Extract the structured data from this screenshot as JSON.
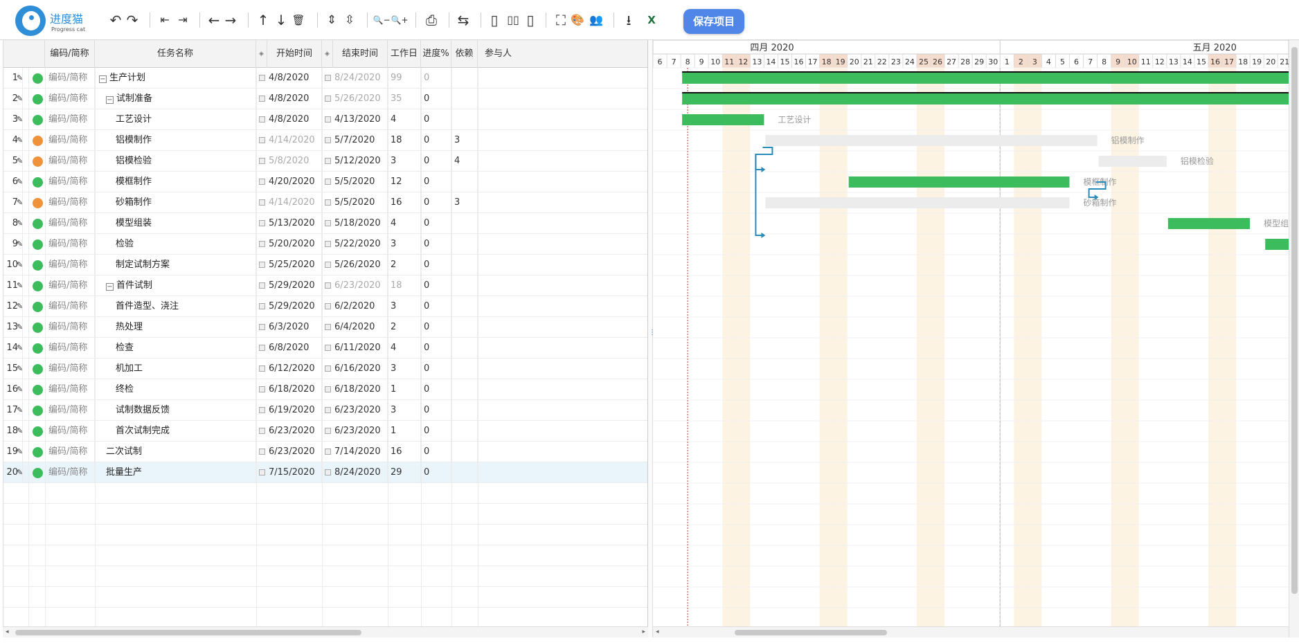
{
  "app": {
    "name": "进度猫",
    "subtitle": "Progress cat"
  },
  "toolbar": {
    "undo": "↶",
    "redo": "↷",
    "outdent": "⇤",
    "indent": "⇥",
    "move_left": "←",
    "move_right": "→",
    "move_up": "↑",
    "move_down": "↓",
    "delete": "🗑",
    "expand_all": "⇕",
    "collapse_all": "⇳",
    "zoom_out": "🔍−",
    "zoom_in": "🔍+",
    "print": "⎙",
    "critical_path": "⇆",
    "layout_grid": "▯",
    "layout_split": "▯▯",
    "layout_gantt": "▯",
    "fullscreen": "⛶",
    "theme": "🎨",
    "members": "👥",
    "export": "⭳",
    "excel": "X",
    "save_label": "保存项目"
  },
  "grid": {
    "headers": {
      "code": "编码/简称",
      "name": "任务名称",
      "start": "开始时间",
      "end": "结束时间",
      "workdays": "工作日",
      "progress": "进度%",
      "depends": "依赖",
      "people": "参与人"
    },
    "rows": [
      {
        "num": "1",
        "status": "green",
        "code": "编码/简称",
        "name": "生产计划",
        "indent": 0,
        "toggle": "−",
        "start": "4/8/2020",
        "start_grey": false,
        "end": "8/24/2020",
        "end_grey": true,
        "workdays": "99",
        "workdays_grey": true,
        "progress": "0",
        "progress_grey": true,
        "depends": ""
      },
      {
        "num": "2",
        "status": "green",
        "code": "编码/简称",
        "name": "试制准备",
        "indent": 1,
        "toggle": "−",
        "start": "4/8/2020",
        "start_grey": false,
        "end": "5/26/2020",
        "end_grey": true,
        "workdays": "35",
        "workdays_grey": true,
        "progress": "0",
        "progress_grey": false,
        "depends": ""
      },
      {
        "num": "3",
        "status": "green",
        "code": "编码/简称",
        "name": "工艺设计",
        "indent": 2,
        "toggle": "",
        "start": "4/8/2020",
        "start_grey": false,
        "end": "4/13/2020",
        "end_grey": false,
        "workdays": "4",
        "workdays_grey": false,
        "progress": "0",
        "progress_grey": false,
        "depends": ""
      },
      {
        "num": "4",
        "status": "orange",
        "code": "编码/简称",
        "name": "铝模制作",
        "indent": 2,
        "toggle": "",
        "start": "4/14/2020",
        "start_grey": true,
        "end": "5/7/2020",
        "end_grey": false,
        "workdays": "18",
        "workdays_grey": false,
        "progress": "0",
        "progress_grey": false,
        "depends": "3"
      },
      {
        "num": "5",
        "status": "orange",
        "code": "编码/简称",
        "name": "铝模检验",
        "indent": 2,
        "toggle": "",
        "start": "5/8/2020",
        "start_grey": true,
        "end": "5/12/2020",
        "end_grey": false,
        "workdays": "3",
        "workdays_grey": false,
        "progress": "0",
        "progress_grey": false,
        "depends": "4"
      },
      {
        "num": "6",
        "status": "green",
        "code": "编码/简称",
        "name": "模框制作",
        "indent": 2,
        "toggle": "",
        "start": "4/20/2020",
        "start_grey": false,
        "end": "5/5/2020",
        "end_grey": false,
        "workdays": "12",
        "workdays_grey": false,
        "progress": "0",
        "progress_grey": false,
        "depends": ""
      },
      {
        "num": "7",
        "status": "orange",
        "code": "编码/简称",
        "name": "砂箱制作",
        "indent": 2,
        "toggle": "",
        "start": "4/14/2020",
        "start_grey": true,
        "end": "5/5/2020",
        "end_grey": false,
        "workdays": "16",
        "workdays_grey": false,
        "progress": "0",
        "progress_grey": false,
        "depends": "3"
      },
      {
        "num": "8",
        "status": "green",
        "code": "编码/简称",
        "name": "模型组装",
        "indent": 2,
        "toggle": "",
        "start": "5/13/2020",
        "start_grey": false,
        "end": "5/18/2020",
        "end_grey": false,
        "workdays": "4",
        "workdays_grey": false,
        "progress": "0",
        "progress_grey": false,
        "depends": ""
      },
      {
        "num": "9",
        "status": "green",
        "code": "编码/简称",
        "name": "检验",
        "indent": 2,
        "toggle": "",
        "start": "5/20/2020",
        "start_grey": false,
        "end": "5/22/2020",
        "end_grey": false,
        "workdays": "3",
        "workdays_grey": false,
        "progress": "0",
        "progress_grey": false,
        "depends": ""
      },
      {
        "num": "10",
        "status": "green",
        "code": "编码/简称",
        "name": "制定试制方案",
        "indent": 2,
        "toggle": "",
        "start": "5/25/2020",
        "start_grey": false,
        "end": "5/26/2020",
        "end_grey": false,
        "workdays": "2",
        "workdays_grey": false,
        "progress": "0",
        "progress_grey": false,
        "depends": ""
      },
      {
        "num": "11",
        "status": "green",
        "code": "编码/简称",
        "name": "首件试制",
        "indent": 1,
        "toggle": "−",
        "start": "5/29/2020",
        "start_grey": false,
        "end": "6/23/2020",
        "end_grey": true,
        "workdays": "18",
        "workdays_grey": true,
        "progress": "0",
        "progress_grey": false,
        "depends": ""
      },
      {
        "num": "12",
        "status": "green",
        "code": "编码/简称",
        "name": "首件造型、浇注",
        "indent": 2,
        "toggle": "",
        "start": "5/29/2020",
        "start_grey": false,
        "end": "6/2/2020",
        "end_grey": false,
        "workdays": "3",
        "workdays_grey": false,
        "progress": "0",
        "progress_grey": false,
        "depends": ""
      },
      {
        "num": "13",
        "status": "green",
        "code": "编码/简称",
        "name": "热处理",
        "indent": 2,
        "toggle": "",
        "start": "6/3/2020",
        "start_grey": false,
        "end": "6/4/2020",
        "end_grey": false,
        "workdays": "2",
        "workdays_grey": false,
        "progress": "0",
        "progress_grey": false,
        "depends": ""
      },
      {
        "num": "14",
        "status": "green",
        "code": "编码/简称",
        "name": "检查",
        "indent": 2,
        "toggle": "",
        "start": "6/8/2020",
        "start_grey": false,
        "end": "6/11/2020",
        "end_grey": false,
        "workdays": "4",
        "workdays_grey": false,
        "progress": "0",
        "progress_grey": false,
        "depends": ""
      },
      {
        "num": "15",
        "status": "green",
        "code": "编码/简称",
        "name": "机加工",
        "indent": 2,
        "toggle": "",
        "start": "6/12/2020",
        "start_grey": false,
        "end": "6/16/2020",
        "end_grey": false,
        "workdays": "3",
        "workdays_grey": false,
        "progress": "0",
        "progress_grey": false,
        "depends": ""
      },
      {
        "num": "16",
        "status": "green",
        "code": "编码/简称",
        "name": "终检",
        "indent": 2,
        "toggle": "",
        "start": "6/18/2020",
        "start_grey": false,
        "end": "6/18/2020",
        "end_grey": false,
        "workdays": "1",
        "workdays_grey": false,
        "progress": "0",
        "progress_grey": false,
        "depends": ""
      },
      {
        "num": "17",
        "status": "green",
        "code": "编码/简称",
        "name": "试制数据反馈",
        "indent": 2,
        "toggle": "",
        "start": "6/19/2020",
        "start_grey": false,
        "end": "6/23/2020",
        "end_grey": false,
        "workdays": "3",
        "workdays_grey": false,
        "progress": "0",
        "progress_grey": false,
        "depends": ""
      },
      {
        "num": "18",
        "status": "green",
        "code": "编码/简称",
        "name": "首次试制完成",
        "indent": 2,
        "toggle": "",
        "start": "6/23/2020",
        "start_grey": false,
        "end": "6/23/2020",
        "end_grey": false,
        "workdays": "1",
        "workdays_grey": false,
        "progress": "0",
        "progress_grey": false,
        "depends": ""
      },
      {
        "num": "19",
        "status": "green",
        "code": "编码/简称",
        "name": "二次试制",
        "indent": 1,
        "toggle": "",
        "start": "6/23/2020",
        "start_grey": false,
        "end": "7/14/2020",
        "end_grey": false,
        "workdays": "16",
        "workdays_grey": false,
        "progress": "0",
        "progress_grey": false,
        "depends": ""
      },
      {
        "num": "20",
        "status": "green",
        "code": "编码/简称",
        "name": "批量生产",
        "indent": 1,
        "toggle": "",
        "start": "7/15/2020",
        "start_grey": false,
        "end": "8/24/2020",
        "end_grey": false,
        "workdays": "29",
        "workdays_grey": false,
        "progress": "0",
        "progress_grey": false,
        "depends": "",
        "selected": true
      }
    ]
  },
  "gantt": {
    "months": [
      "四月 2020",
      "五月 2020"
    ],
    "april_days": [
      "6",
      "7",
      "8",
      "9",
      "10",
      "11",
      "12",
      "13",
      "14",
      "15",
      "16",
      "17",
      "18",
      "19",
      "20",
      "21",
      "22",
      "23",
      "24",
      "25",
      "26",
      "27",
      "28",
      "29",
      "30"
    ],
    "may_days": [
      "1",
      "2",
      "3",
      "4",
      "5",
      "6",
      "7",
      "8",
      "9",
      "10",
      "11",
      "12",
      "13",
      "14",
      "15",
      "16",
      "17",
      "18",
      "19",
      "20",
      "21"
    ],
    "weekend_days_april": [
      "11",
      "12",
      "18",
      "19",
      "25",
      "26"
    ],
    "weekend_days_may": [
      "2",
      "3",
      "9",
      "10",
      "16",
      "17"
    ],
    "bar_labels": {
      "r3": "工艺设计",
      "r4": "铝模制作",
      "r5": "铝模检验",
      "r6": "模框制作",
      "r7": "砂箱制作",
      "r8": "模型组装"
    },
    "colors": {
      "bar": "#3cbc5c",
      "summary": "#111111",
      "unscheduled": "#ececec",
      "link": "#2a8ab8",
      "weekend": "#fdf3e3",
      "weekend_header": "#f6dccd",
      "today": "#c0392b"
    }
  },
  "status_colors": {
    "green": "#3cbc5c",
    "orange": "#f0923a"
  }
}
